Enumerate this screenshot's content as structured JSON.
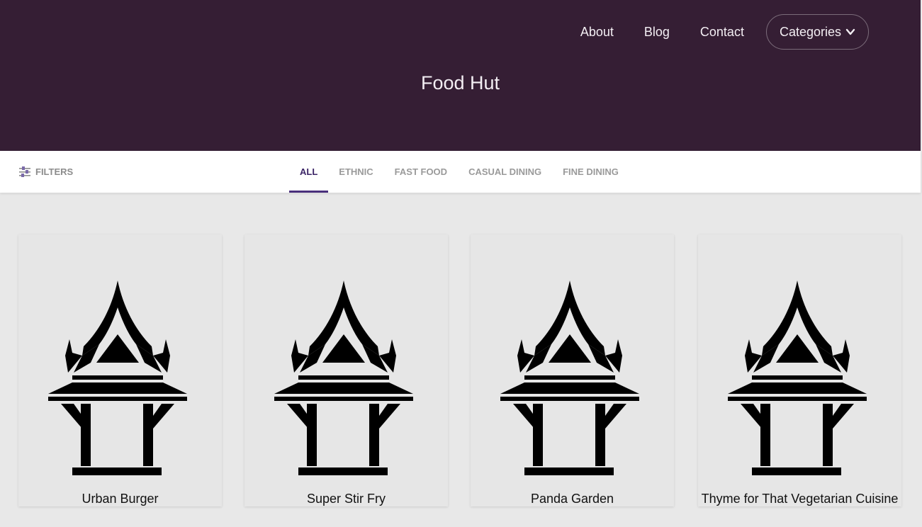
{
  "nav": {
    "links": [
      "About",
      "Blog",
      "Contact"
    ],
    "categories_label": "Categories"
  },
  "site_title": "Food Hut",
  "filterbar": {
    "filters_label": "FILTERS",
    "tabs": [
      "ALL",
      "ETHNIC",
      "FAST FOOD",
      "CASUAL DINING",
      "FINE DINING"
    ],
    "active_tab": "ALL"
  },
  "restaurants": [
    {
      "name": "Urban Burger",
      "icon": "pavilion-icon"
    },
    {
      "name": "Super Stir Fry",
      "icon": "pavilion-icon"
    },
    {
      "name": "Panda Garden",
      "icon": "pavilion-icon"
    },
    {
      "name": "Thyme for That Vegetarian Cuisine",
      "icon": "pavilion-icon"
    }
  ],
  "colors": {
    "header_bg": "#351e34",
    "accent": "#4a2f7c",
    "page_bg": "#e8e8e8"
  }
}
